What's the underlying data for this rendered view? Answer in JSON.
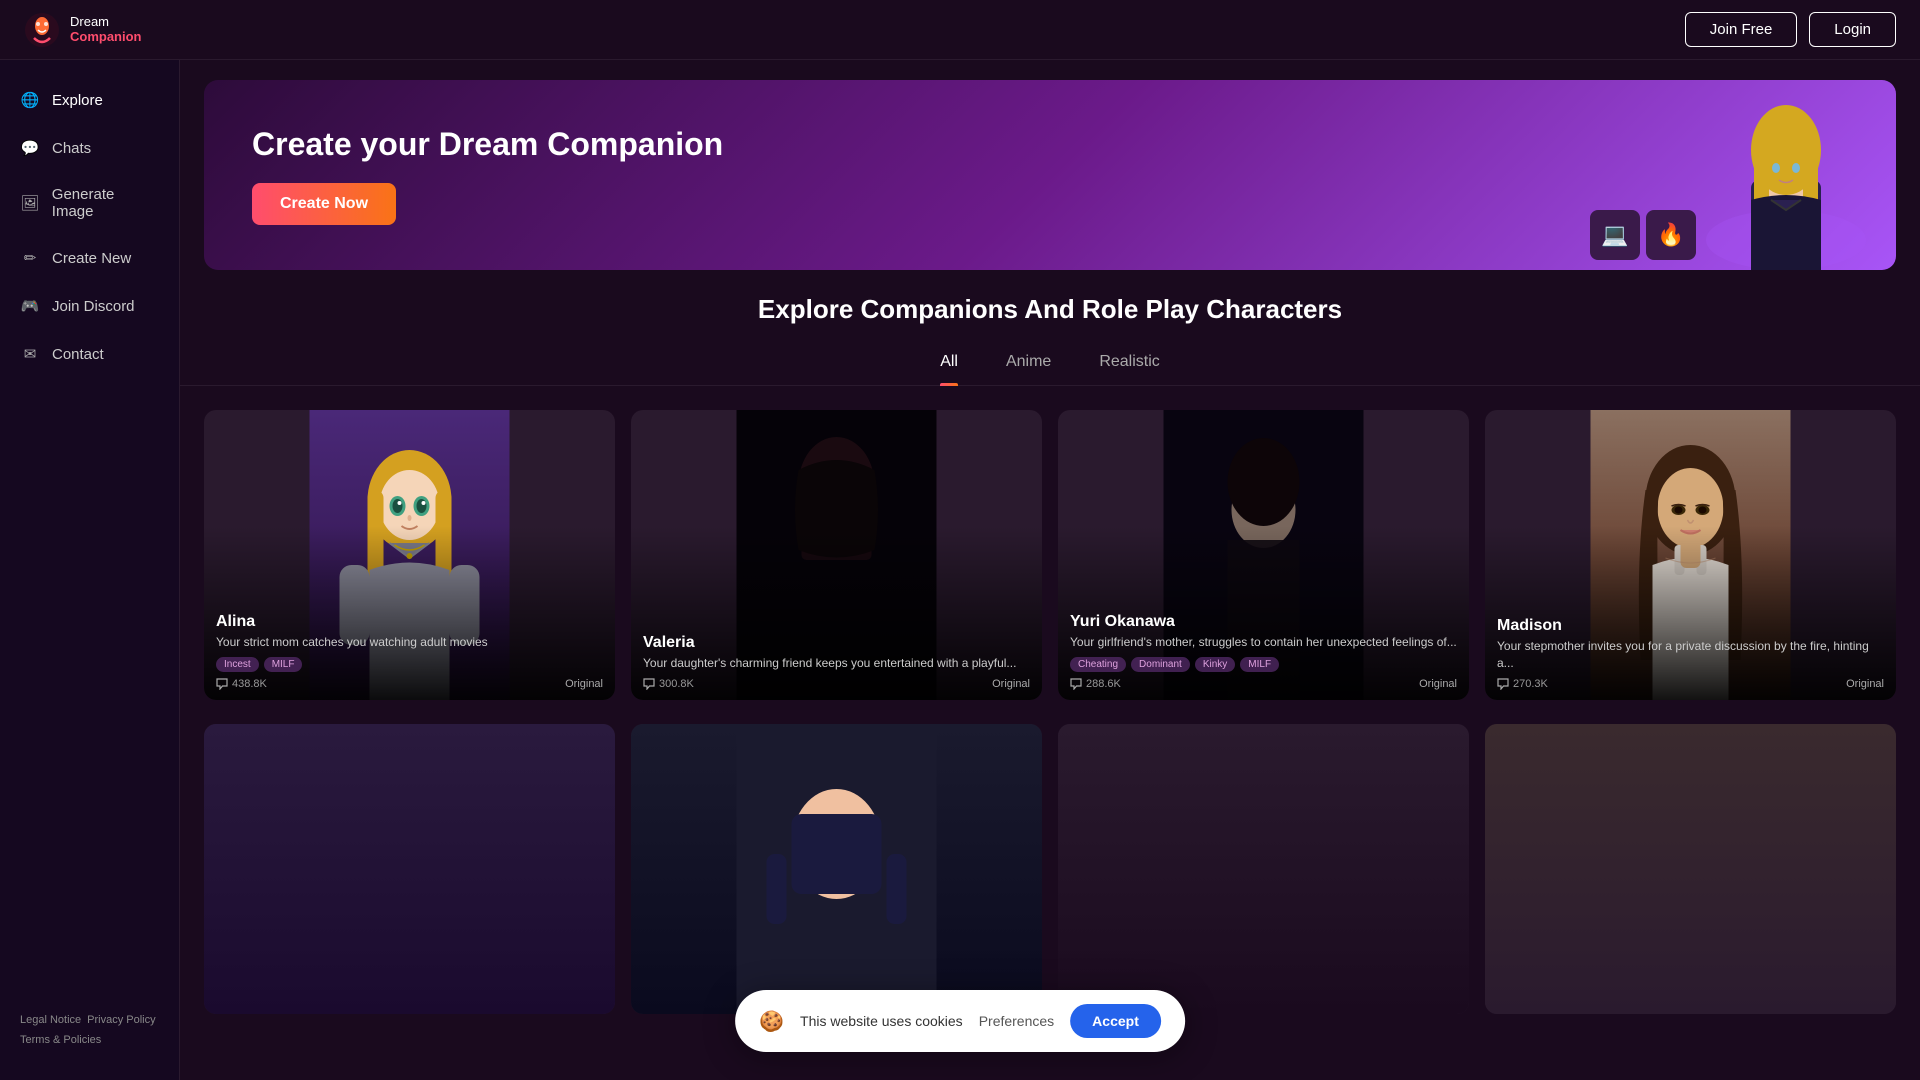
{
  "header": {
    "logo_dream": "Dream",
    "logo_companion": "Companion",
    "join_free_label": "Join Free",
    "login_label": "Login"
  },
  "sidebar": {
    "items": [
      {
        "id": "explore",
        "label": "Explore",
        "icon": "globe"
      },
      {
        "id": "chats",
        "label": "Chats",
        "icon": "chat"
      },
      {
        "id": "generate-image",
        "label": "Generate Image",
        "icon": "image"
      },
      {
        "id": "create-new",
        "label": "Create New",
        "icon": "wand"
      },
      {
        "id": "join-discord",
        "label": "Join Discord",
        "icon": "discord"
      },
      {
        "id": "contact",
        "label": "Contact",
        "icon": "mail"
      }
    ],
    "footer_links": [
      {
        "id": "legal",
        "label": "Legal Notice"
      },
      {
        "id": "privacy",
        "label": "Privacy Policy"
      },
      {
        "id": "terms",
        "label": "Terms & Policies"
      }
    ]
  },
  "hero": {
    "title": "Create your Dream Companion",
    "cta_label": "Create Now"
  },
  "explore_section": {
    "title": "Explore Companions And Role Play Characters",
    "tabs": [
      {
        "id": "all",
        "label": "All",
        "active": true
      },
      {
        "id": "anime",
        "label": "Anime",
        "active": false
      },
      {
        "id": "realistic",
        "label": "Realistic",
        "active": false
      }
    ]
  },
  "cards": [
    {
      "id": "alina",
      "name": "Alina",
      "description": "Your strict mom catches you watching adult movies",
      "tags": [
        "Incest",
        "MILF"
      ],
      "messages": "438.8K",
      "badge": "Original",
      "style": "anime"
    },
    {
      "id": "valeria",
      "name": "Valeria",
      "description": "Your daughter's charming friend keeps you entertained with a playful...",
      "tags": [],
      "messages": "300.8K",
      "badge": "Original",
      "style": "anime"
    },
    {
      "id": "yuri-okanawa",
      "name": "Yuri Okanawa",
      "description": "Your girlfriend's mother, struggles to contain her unexpected feelings of...",
      "tags": [
        "Cheating",
        "Dominant",
        "Kinky",
        "MILF"
      ],
      "messages": "288.6K",
      "badge": "Original",
      "style": "anime"
    },
    {
      "id": "madison",
      "name": "Madison",
      "description": "Your stepmother invites you for a private discussion by the fire, hinting a...",
      "tags": [],
      "messages": "270.3K",
      "badge": "Original",
      "style": "realistic"
    }
  ],
  "cookie": {
    "text": "This website uses cookies",
    "preferences_label": "Preferences",
    "accept_label": "Accept"
  }
}
